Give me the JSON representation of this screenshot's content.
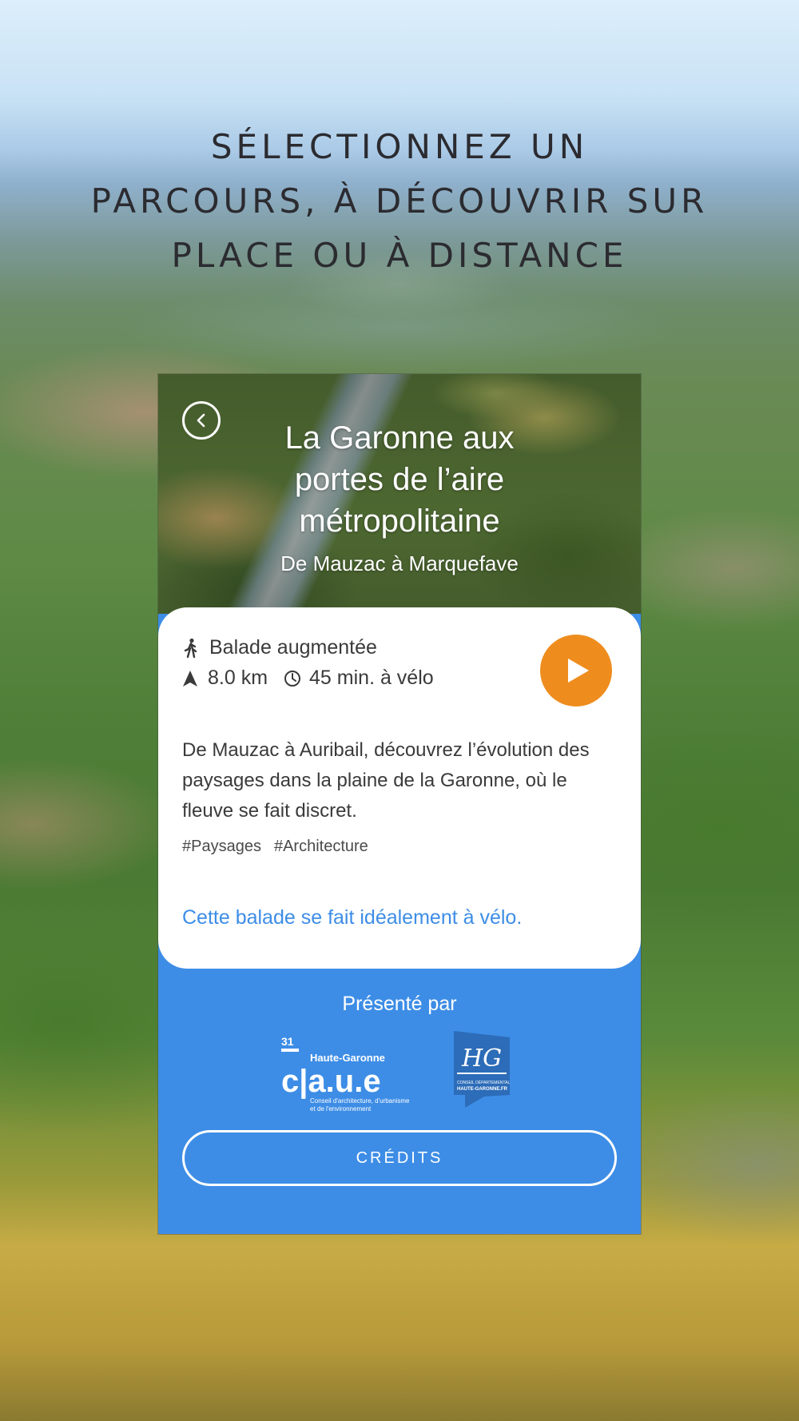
{
  "headline": {
    "line1": "SÉLECTIONNEZ UN",
    "line2": "PARCOURS, À DÉCOUVRIR SUR",
    "line3": "PLACE OU À DISTANCE"
  },
  "route": {
    "title_line1": "La Garonne aux",
    "title_line2": "portes de l’aire",
    "title_line3": "métropolitaine",
    "subtitle": "De Mauzac à Marquefave",
    "type": "Balade augmentée",
    "distance": "8.0 km",
    "duration": "45 min. à vélo",
    "description": "De Mauzac à Auribail, découvrez l’évolution des paysages dans la plaine de la Garonne, où le fleuve se fait discret.",
    "tags": [
      "#Paysages",
      "#Architecture"
    ],
    "note": "Cette balade se fait idéalement à vélo."
  },
  "footer": {
    "presented_by": "Présenté par",
    "caue_number": "31",
    "caue_region": "Haute-Garonne",
    "caue_name": "c|a.u.e",
    "caue_tagline_1": "Conseil d'architecture, d'urbanisme",
    "caue_tagline_2": "et de l'environnement",
    "hg_logo_text": "HG",
    "hg_caption_1": "CONSEIL DÉPARTEMENTAL",
    "hg_caption_2": "HAUTE-GARONNE.FR",
    "credits_label": "CRÉDITS"
  },
  "colors": {
    "accent_blue": "#3d8de6",
    "play_orange": "#ee8d1e",
    "headline_text": "#2b2b30"
  },
  "icons": {
    "back": "chevron-left-icon",
    "walk": "walking-person-icon",
    "distance": "navigation-arrow-icon",
    "duration": "clock-icon",
    "play": "play-icon"
  }
}
